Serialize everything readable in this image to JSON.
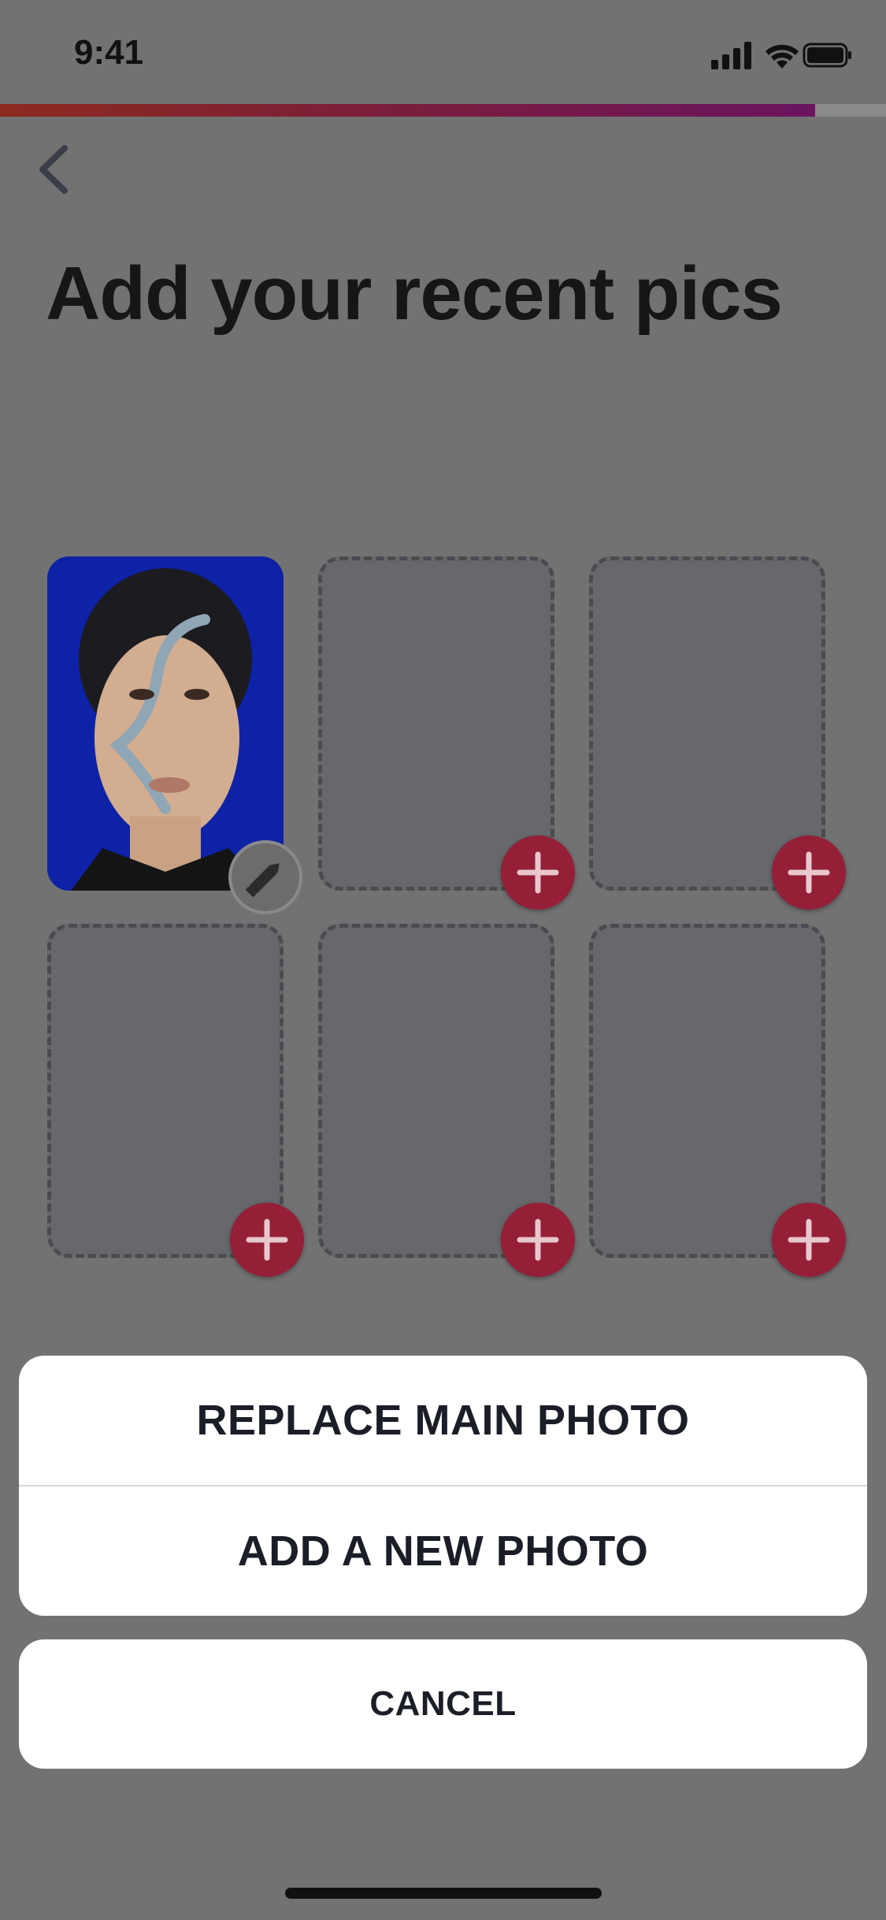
{
  "status_bar": {
    "time": "9:41",
    "icons": [
      "cellular-signal-icon",
      "wifi-icon",
      "battery-icon"
    ]
  },
  "onboarding": {
    "progress_percent": 92,
    "progress_colors": [
      "#8c2a1e",
      "#6a1460"
    ]
  },
  "header": {
    "back_icon": "chevron-left-icon",
    "title": "Add your recent pics"
  },
  "photo_grid": {
    "slots": [
      {
        "state": "filled",
        "action_icon": "pencil-icon"
      },
      {
        "state": "empty",
        "action_icon": "plus-icon"
      },
      {
        "state": "empty",
        "action_icon": "plus-icon"
      },
      {
        "state": "empty",
        "action_icon": "plus-icon"
      },
      {
        "state": "empty",
        "action_icon": "plus-icon"
      },
      {
        "state": "empty",
        "action_icon": "plus-icon"
      }
    ],
    "accent_color": "#941f37"
  },
  "action_sheet": {
    "replace_label": "REPLACE MAIN PHOTO",
    "add_label": "ADD A NEW PHOTO",
    "cancel_label": "CANCEL"
  }
}
